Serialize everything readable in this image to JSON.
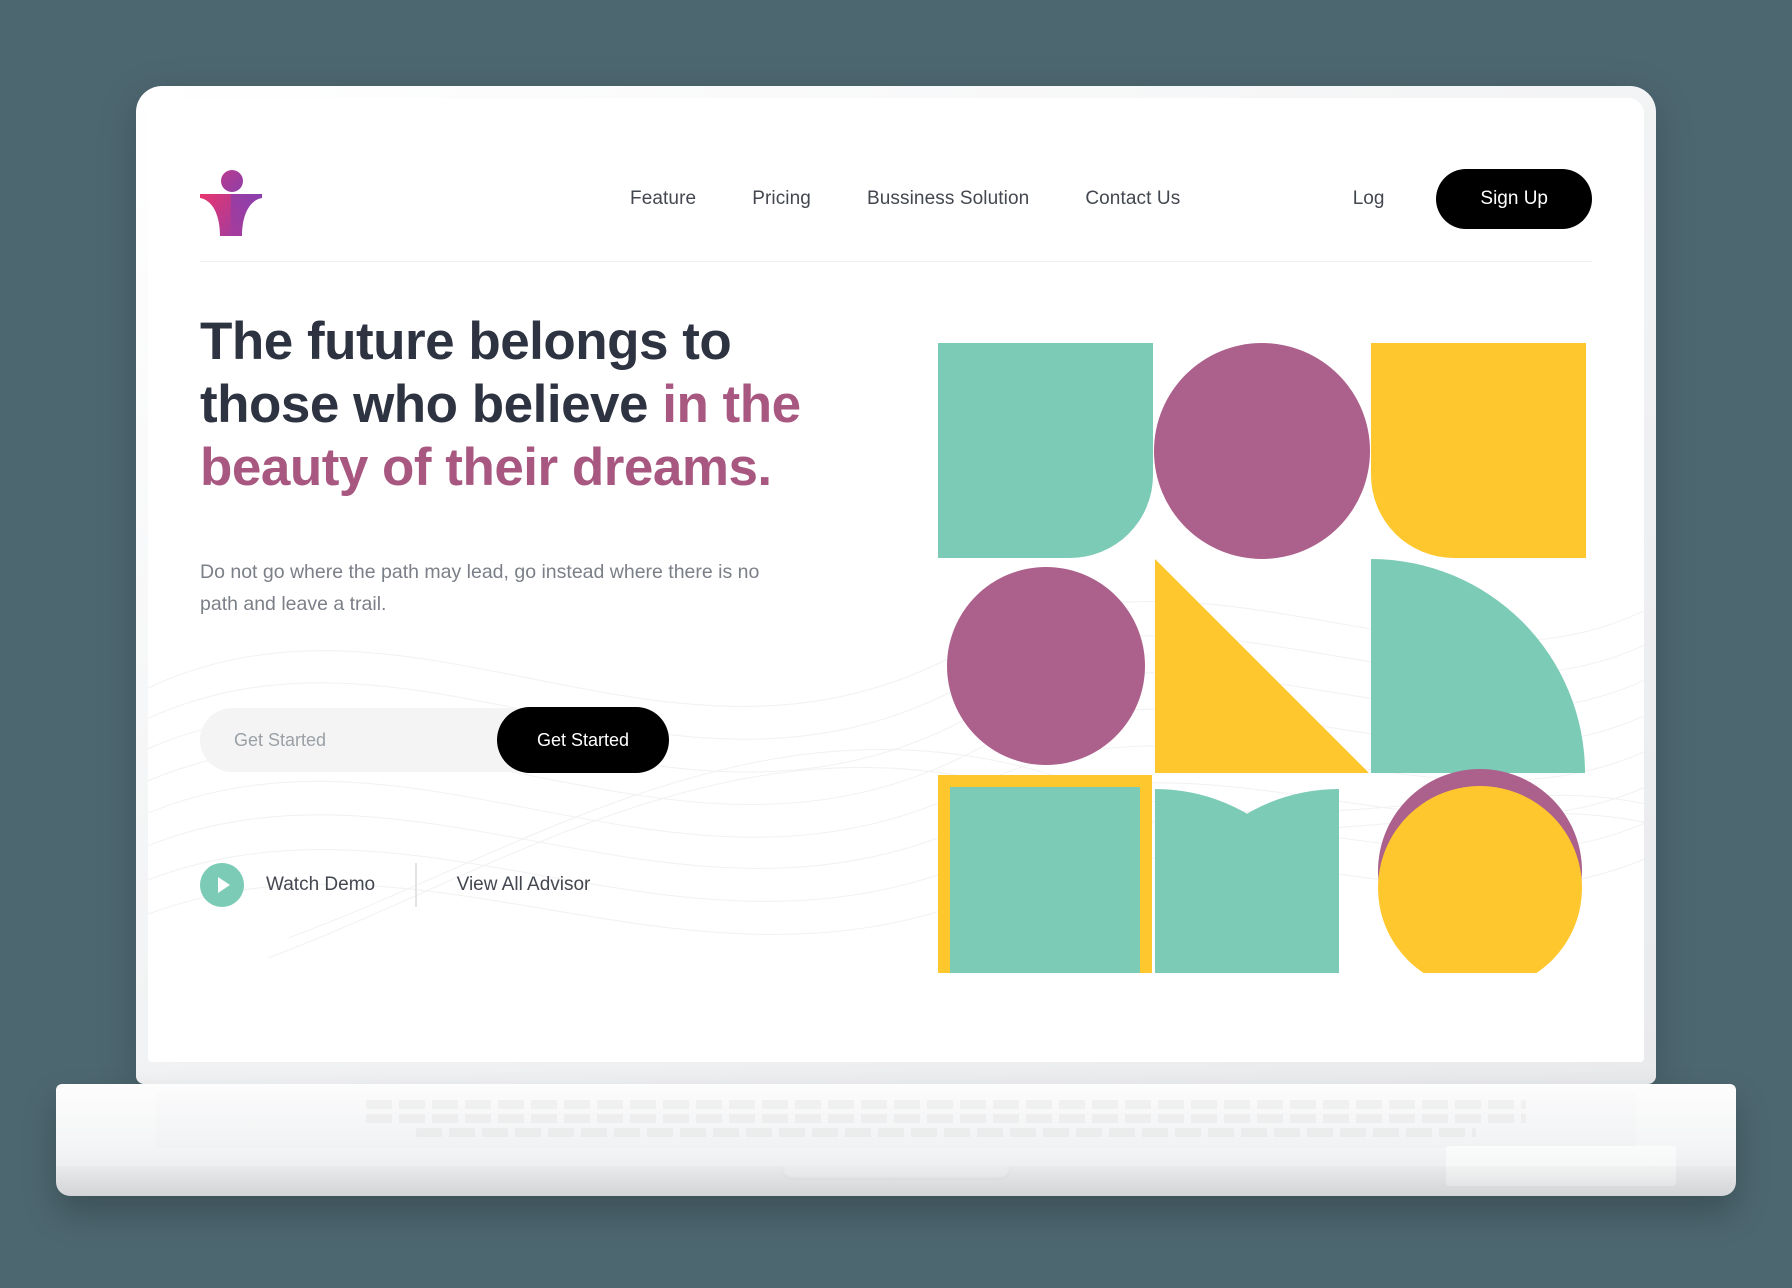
{
  "brand": {
    "logo_name": "logo-person-book",
    "colors": {
      "green": "#7ccbb6",
      "purple": "#ac608c",
      "yellow": "#ffc72e",
      "dark": "#2e3342",
      "accent_text": "#a85880",
      "page_background": "#4d6770",
      "black_button": "#000000"
    }
  },
  "nav": {
    "items": [
      {
        "label": "Feature"
      },
      {
        "label": "Pricing"
      },
      {
        "label": "Bussiness Solution"
      },
      {
        "label": "Contact Us"
      }
    ],
    "login_label": "Log",
    "signup_label": "Sign Up"
  },
  "hero": {
    "headline_part1": "The future belongs to those who believe ",
    "headline_part2": "in the beauty of their dreams.",
    "subtext": "Do not go where the path may lead, go instead where there is no path and leave a trail.",
    "email_placeholder": "Get Started",
    "email_value": "",
    "cta_label": "Get Started",
    "watch_demo_label": "Watch Demo",
    "view_advisor_label": "View All Advisor"
  },
  "artwork": {
    "name": "geometric-shape-grid",
    "description": "3x3 grid of abstract geometric shapes",
    "cells": [
      {
        "row": 1,
        "col": 1,
        "shape": "square-rounded-bottom-right",
        "color": "#7ccbb6"
      },
      {
        "row": 1,
        "col": 2,
        "shape": "circle",
        "color": "#ac608c"
      },
      {
        "row": 1,
        "col": 3,
        "shape": "square-rounded-bottom-left",
        "color": "#ffc72e"
      },
      {
        "row": 2,
        "col": 1,
        "shape": "circle",
        "color": "#ac608c"
      },
      {
        "row": 2,
        "col": 2,
        "shape": "triangle",
        "color": "#ffc72e"
      },
      {
        "row": 2,
        "col": 3,
        "shape": "quarter-circle",
        "color": "#7ccbb6"
      },
      {
        "row": 3,
        "col": 1,
        "shape": "square-outlined",
        "color": "#7ccbb6",
        "border_color": "#ffc72e"
      },
      {
        "row": 3,
        "col": 2,
        "shape": "quarter-circle-fill",
        "color": "#7ccbb6"
      },
      {
        "row": 3,
        "col": 3,
        "shape": "circle-with-crescent",
        "color": "#ffc72e",
        "accent_color": "#ac608c"
      }
    ]
  }
}
